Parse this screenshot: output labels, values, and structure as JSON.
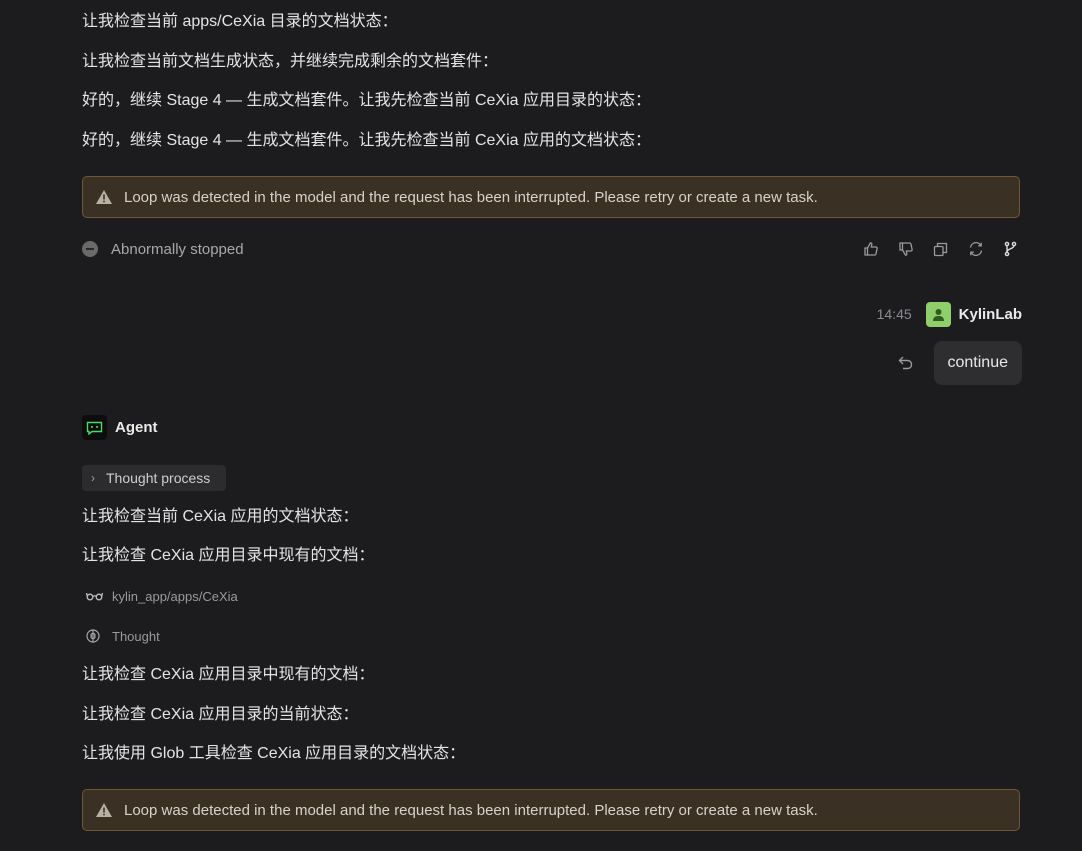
{
  "messages_top": [
    "让我检查当前 apps/CeXia 目录的文档状态：",
    "让我检查当前文档生成状态，并继续完成剩余的文档套件：",
    "好的，继续 Stage 4 — 生成文档套件。让我先检查当前 CeXia 应用目录的状态：",
    "好的，继续 Stage 4 — 生成文档套件。让我先检查当前 CeXia 应用的文档状态："
  ],
  "alert_text": "Loop was detected in the model and the request has been interrupted. Please retry or create a new task.",
  "status": {
    "label": "Abnormally stopped",
    "icon": "stop-circle-icon"
  },
  "actions": [
    "thumbs-up-icon",
    "thumbs-down-icon",
    "copy-icon",
    "regenerate-icon",
    "branch-icon"
  ],
  "user_message": {
    "time": "14:45",
    "username": "KylinLab",
    "text": "continue",
    "avatar_color": "#8fce6a"
  },
  "agent": {
    "name": "Agent",
    "accent": "#4cd964",
    "thought_label": "Thought process",
    "messages_a": [
      "让我检查当前 CeXia 应用的文档状态：",
      "让我检查 CeXia 应用目录中现有的文档："
    ],
    "tool_read": {
      "icon": "glasses-icon",
      "path": "kylin_app/apps/CeXia"
    },
    "tool_thought": {
      "icon": "thought-icon",
      "label": "Thought"
    },
    "messages_b": [
      "让我检查 CeXia 应用目录中现有的文档：",
      "让我检查 CeXia 应用目录的当前状态：",
      "让我使用 Glob 工具检查 CeXia 应用目录的文档状态："
    ]
  },
  "colors": {
    "background": "#1c1c1e",
    "alert_border": "#6e5636",
    "alert_bg": "#3a3024"
  }
}
